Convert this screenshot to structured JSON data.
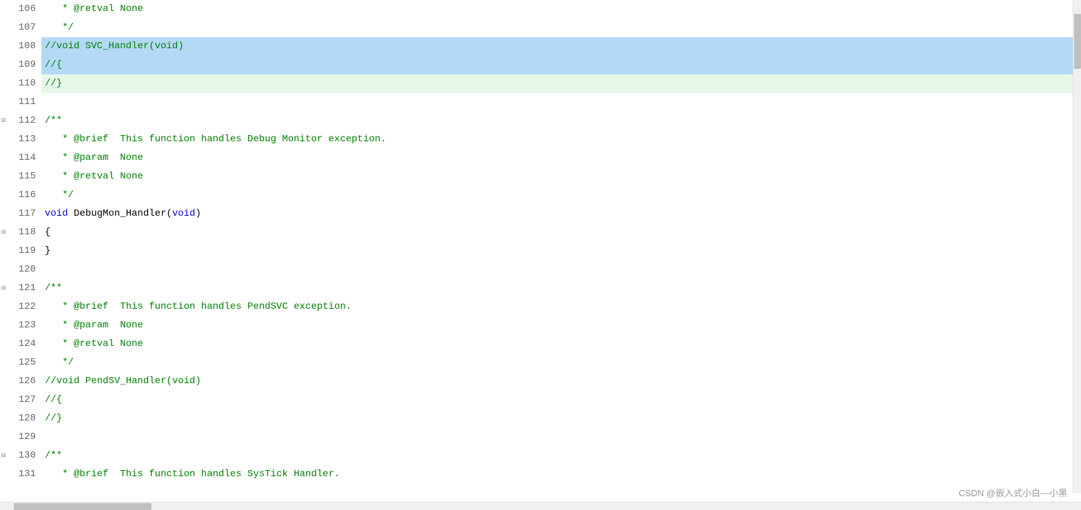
{
  "editor": {
    "lines": [
      {
        "num": "106",
        "content": "   * @retval None",
        "highlight": "normal",
        "type": "comment"
      },
      {
        "num": "107",
        "content": "   */",
        "highlight": "normal",
        "type": "comment"
      },
      {
        "num": "108",
        "content": "//void SVC_Handler(void)",
        "highlight": "blue",
        "type": "comment"
      },
      {
        "num": "109",
        "content": "//{",
        "highlight": "blue",
        "type": "comment"
      },
      {
        "num": "110",
        "content": "//}",
        "highlight": "green",
        "type": "comment"
      },
      {
        "num": "111",
        "content": "",
        "highlight": "normal",
        "type": "normal"
      },
      {
        "num": "112",
        "content": "/**",
        "highlight": "normal",
        "type": "comment",
        "fold": true
      },
      {
        "num": "113",
        "content": "   * @brief  This function handles Debug Monitor exception.",
        "highlight": "normal",
        "type": "comment"
      },
      {
        "num": "114",
        "content": "   * @param  None",
        "highlight": "normal",
        "type": "comment"
      },
      {
        "num": "115",
        "content": "   * @retval None",
        "highlight": "normal",
        "type": "comment"
      },
      {
        "num": "116",
        "content": "   */",
        "highlight": "normal",
        "type": "comment"
      },
      {
        "num": "117",
        "content": "void DebugMon_Handler(void)",
        "highlight": "normal",
        "type": "code"
      },
      {
        "num": "118",
        "content": "{",
        "highlight": "normal",
        "type": "code",
        "fold": true
      },
      {
        "num": "119",
        "content": "}",
        "highlight": "normal",
        "type": "code"
      },
      {
        "num": "120",
        "content": "",
        "highlight": "normal",
        "type": "normal"
      },
      {
        "num": "121",
        "content": "/**",
        "highlight": "normal",
        "type": "comment",
        "fold": true
      },
      {
        "num": "122",
        "content": "   * @brief  This function handles PendSVC exception.",
        "highlight": "normal",
        "type": "comment"
      },
      {
        "num": "123",
        "content": "   * @param  None",
        "highlight": "normal",
        "type": "comment"
      },
      {
        "num": "124",
        "content": "   * @retval None",
        "highlight": "normal",
        "type": "comment"
      },
      {
        "num": "125",
        "content": "   */",
        "highlight": "normal",
        "type": "comment"
      },
      {
        "num": "126",
        "content": "//void PendSV_Handler(void)",
        "highlight": "normal",
        "type": "comment"
      },
      {
        "num": "127",
        "content": "//{",
        "highlight": "normal",
        "type": "comment"
      },
      {
        "num": "128",
        "content": "//}",
        "highlight": "normal",
        "type": "comment"
      },
      {
        "num": "129",
        "content": "",
        "highlight": "normal",
        "type": "normal"
      },
      {
        "num": "130",
        "content": "/**",
        "highlight": "normal",
        "type": "comment",
        "fold": true
      },
      {
        "num": "131",
        "content": "   * @brief  This function handles SysTick Handler.",
        "highlight": "normal",
        "type": "comment"
      }
    ],
    "watermark": "CSDN @嵌入式小白—小黑"
  }
}
